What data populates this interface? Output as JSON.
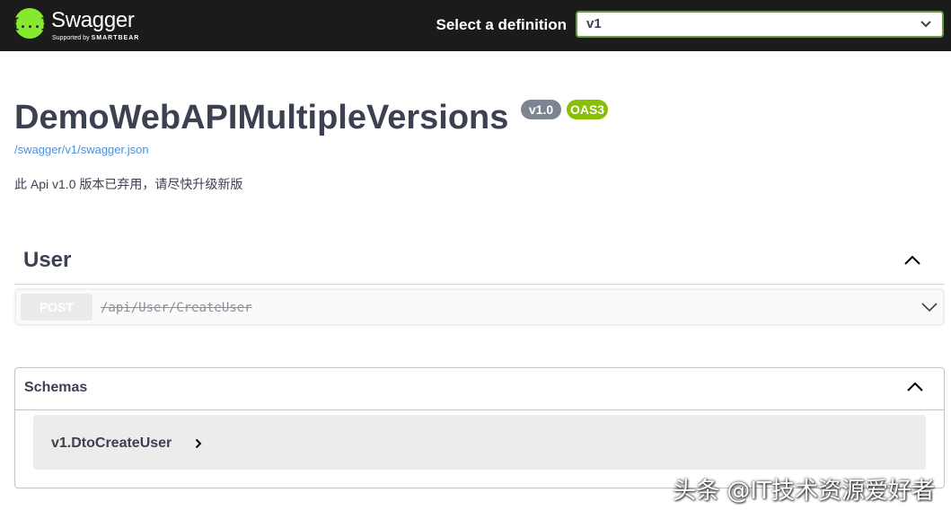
{
  "topbar": {
    "logo_glyph": "{...}",
    "logo_name": "Swagger",
    "logo_sub_prefix": "Supported by",
    "logo_sub_brand": "SMARTBEAR",
    "definition_label": "Select a definition",
    "definition_value": "v1",
    "accent_color": "#85ea2d"
  },
  "info": {
    "title": "DemoWebAPIMultipleVersions",
    "version_badge": "v1.0",
    "oas_badge": "OAS3",
    "spec_link": "/swagger/v1/swagger.json",
    "description": "此 Api v1.0 版本已弃用，请尽快升级新版"
  },
  "tags": [
    {
      "name": "User",
      "expanded": true,
      "operations": [
        {
          "method": "POST",
          "path": "/api/User/CreateUser",
          "deprecated": true
        }
      ]
    }
  ],
  "schemas": {
    "title": "Schemas",
    "expanded": true,
    "models": [
      "v1.DtoCreateUser"
    ]
  },
  "watermark": "头条 @IT技术资源爱好者",
  "colors": {
    "topbar_bg": "#1b1b1b",
    "version_badge": "#7d8492",
    "oas_badge": "#89bf04",
    "link": "#4990e2"
  }
}
